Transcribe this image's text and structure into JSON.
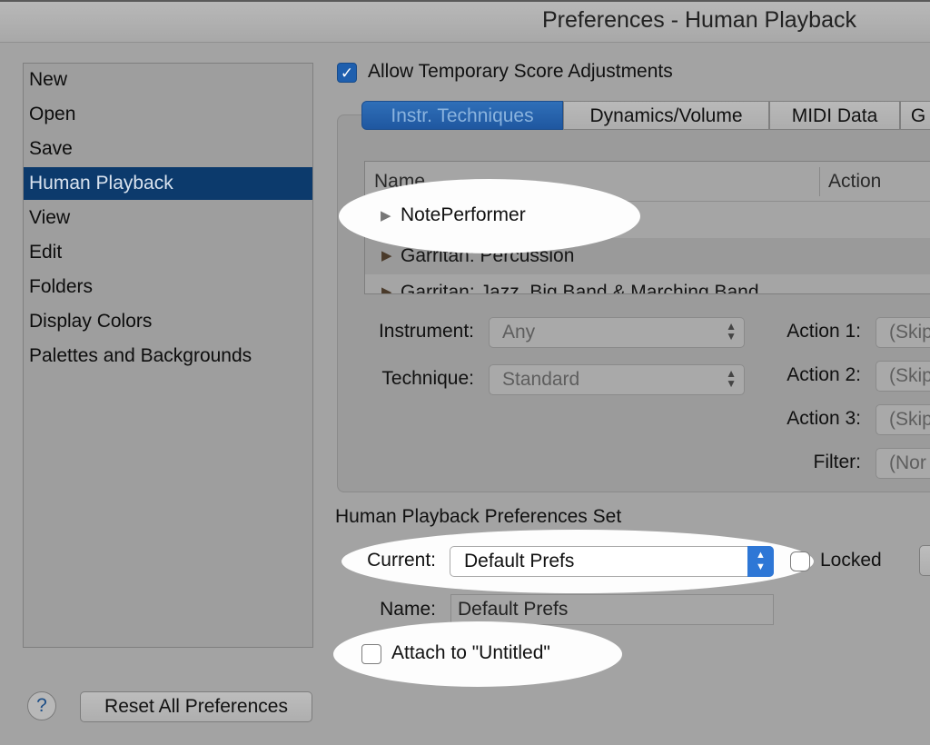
{
  "window": {
    "title": "Preferences - Human Playback"
  },
  "sidebar": {
    "items": [
      {
        "label": "New"
      },
      {
        "label": "Open"
      },
      {
        "label": "Save"
      },
      {
        "label": "Human Playback"
      },
      {
        "label": "View"
      },
      {
        "label": "Edit"
      },
      {
        "label": "Folders"
      },
      {
        "label": "Display Colors"
      },
      {
        "label": "Palettes and Backgrounds"
      }
    ],
    "selected": "Human Playback"
  },
  "footer": {
    "help_label": "?",
    "reset_label": "Reset All Preferences"
  },
  "main": {
    "allow_adjustments": {
      "label": "Allow Temporary Score Adjustments",
      "checked": true,
      "check_glyph": "✓"
    },
    "tabs": [
      {
        "label": "Instr. Techniques"
      },
      {
        "label": "Dynamics/Volume"
      },
      {
        "label": "MIDI Data"
      },
      {
        "label": "G"
      }
    ],
    "active_tab": "Instr. Techniques",
    "table": {
      "columns": [
        "Name",
        "Action"
      ],
      "rows": [
        {
          "name": "NotePerformer"
        },
        {
          "name": "Garritan: Percussion"
        },
        {
          "name": "Garritan: Jazz, Big Band & Marching Band"
        }
      ]
    },
    "fields": {
      "instrument": {
        "label": "Instrument:",
        "value": "Any"
      },
      "technique": {
        "label": "Technique:",
        "value": "Standard"
      },
      "action1": {
        "label": "Action 1:",
        "value": "(Skip"
      },
      "action2": {
        "label": "Action 2:",
        "value": "(Skip"
      },
      "action3": {
        "label": "Action 3:",
        "value": "(Skip"
      },
      "filter": {
        "label": "Filter:",
        "value": "(Nor"
      }
    },
    "prefs_set": {
      "title": "Human Playback Preferences Set",
      "current_label": "Current:",
      "current_value": "Default Prefs",
      "locked_label": "Locked",
      "locked": false,
      "name_label": "Name:",
      "name_value": "Default Prefs",
      "attach_label": "Attach to \"Untitled\"",
      "attach_checked": false
    }
  },
  "colors": {
    "window_bg": "#a3a3a3",
    "selection": "#0c3a6c",
    "accent": "#2e77d6",
    "highlight_oval": "#fdfdfd"
  }
}
